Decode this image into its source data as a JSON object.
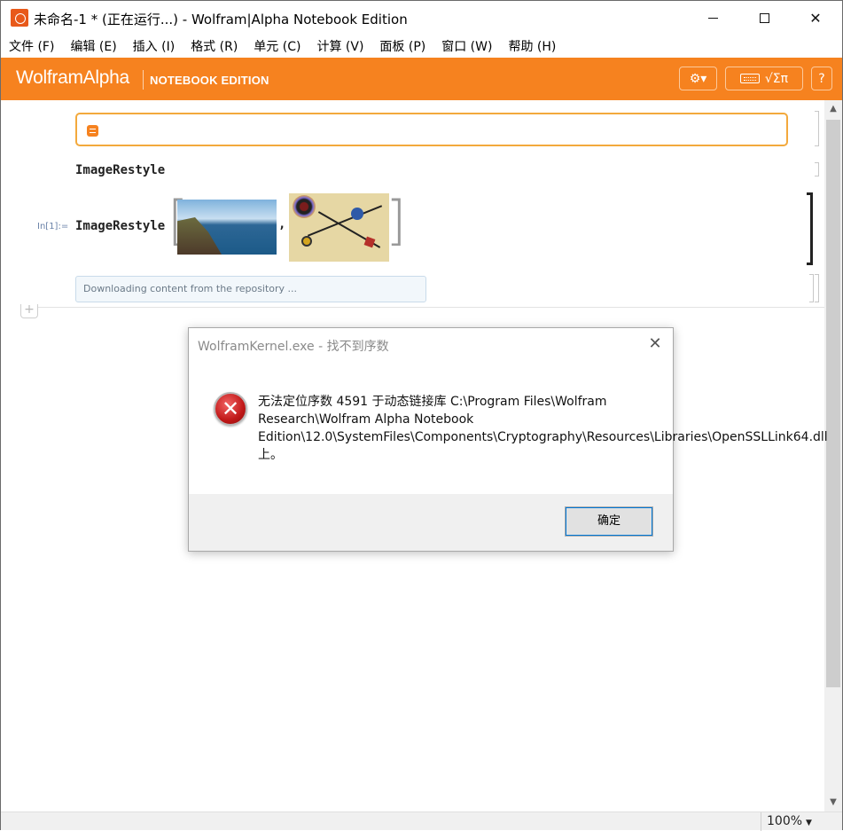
{
  "window": {
    "title": "未命名-1 * (正在运行...) - Wolfram|Alpha Notebook Edition",
    "minimize_glyph": "",
    "close_glyph": "✕"
  },
  "menu": {
    "items": [
      {
        "label": "文件 (F)"
      },
      {
        "label": "编辑 (E)"
      },
      {
        "label": "插入 (I)"
      },
      {
        "label": "格式 (R)"
      },
      {
        "label": "单元 (C)"
      },
      {
        "label": "计算 (V)"
      },
      {
        "label": "面板 (P)"
      },
      {
        "label": "窗口 (W)"
      },
      {
        "label": "帮助 (H)"
      }
    ]
  },
  "toolbar": {
    "brand": "WolframAlpha",
    "brand_sub": "NOTEBOOK EDITION",
    "gear_glyph": "⚙▾",
    "palette_label": "√Σπ",
    "help_label": "?",
    "accent_color": "#f6821f"
  },
  "notebook": {
    "text_cell": "ImageRestyle",
    "in_label": "In[1]:=",
    "function_name": "ImageRestyle",
    "comma": ",",
    "status": "Downloading content from the repository ...",
    "add_cell_glyph": "+"
  },
  "statusbar": {
    "zoom": "100%",
    "zoom_caret": "▼"
  },
  "scrollbar": {
    "up": "▲",
    "down": "▼"
  },
  "dialog": {
    "title": "WolframKernel.exe - 找不到序数",
    "close_glyph": "✕",
    "icon_glyph": "✕",
    "message": "无法定位序数 4591 于动态链接库 C:\\Program Files\\Wolfram Research\\Wolfram Alpha Notebook Edition\\12.0\\SystemFiles\\Components\\Cryptography\\Resources\\Libraries\\OpenSSLLink64.dll 上。",
    "ok_label": "确定"
  }
}
